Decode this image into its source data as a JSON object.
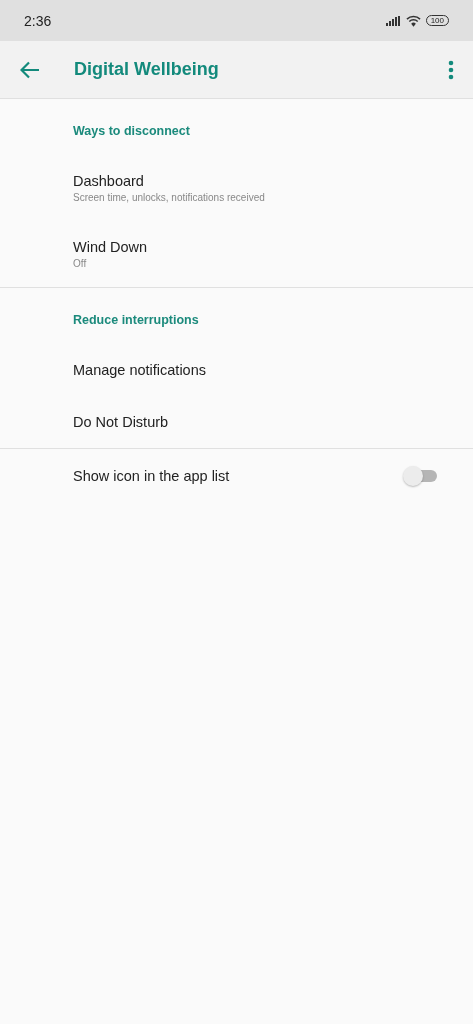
{
  "status_bar": {
    "time": "2:36",
    "battery": "100"
  },
  "app_bar": {
    "title": "Digital Wellbeing"
  },
  "sections": [
    {
      "header": "Ways to disconnect",
      "items": [
        {
          "kind": "link",
          "title": "Dashboard",
          "subtitle": "Screen time, unlocks, notifications received"
        },
        {
          "kind": "link",
          "title": "Wind Down",
          "subtitle": "Off"
        }
      ]
    },
    {
      "header": "Reduce interruptions",
      "items": [
        {
          "kind": "link",
          "title": "Manage notifications"
        },
        {
          "kind": "link",
          "title": "Do Not Disturb"
        }
      ]
    },
    {
      "items": [
        {
          "kind": "switch",
          "title": "Show icon in the app list",
          "on": false
        }
      ]
    }
  ]
}
